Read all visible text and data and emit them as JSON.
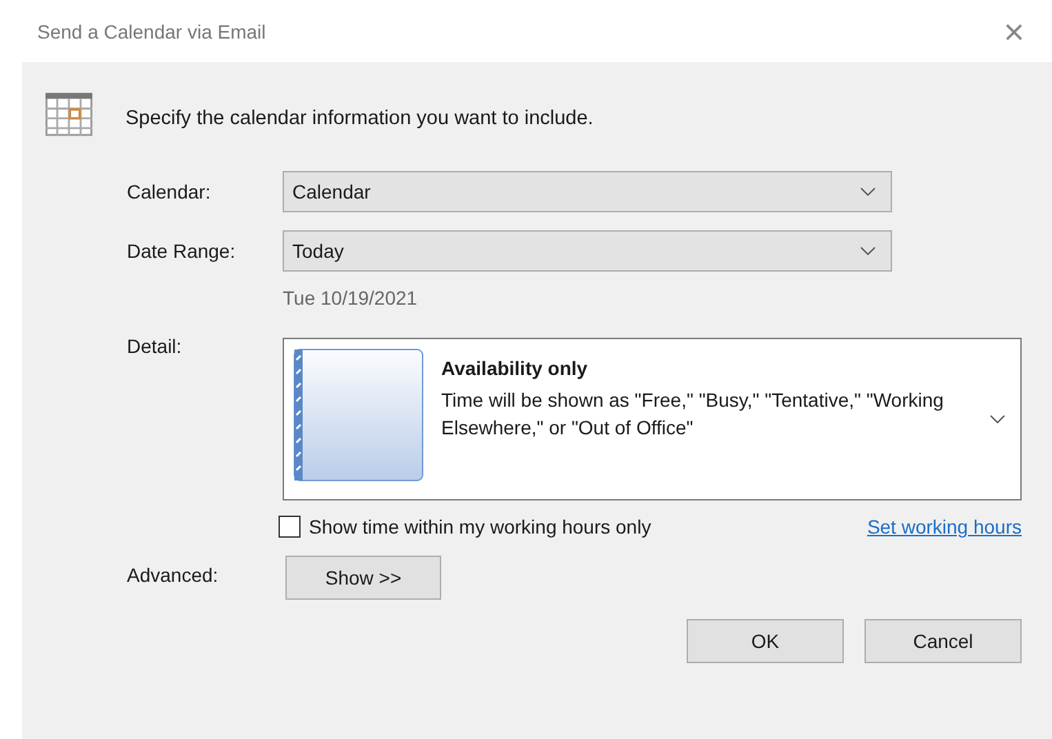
{
  "window": {
    "title": "Send a Calendar via Email",
    "close": "×"
  },
  "heading": "Specify the calendar information you want to include.",
  "fields": [
    {
      "label": "Calendar:",
      "value": "Calendar"
    },
    {
      "label": "Date Range:",
      "value": "Today"
    }
  ],
  "date_note": "Tue 10/19/2021",
  "detail": {
    "label": "Detail:",
    "title": "Availability only",
    "description": "Time will be shown as \"Free,\" \"Busy,\" \"Tentative,\" \"Working Elsewhere,\" or \"Out of Office\""
  },
  "working_hours": {
    "label": "Show time within my working hours only",
    "checked": false,
    "link": "Set working hours"
  },
  "advanced": {
    "label": "Advanced:",
    "button": "Show >>"
  },
  "buttons": [
    "OK",
    "Cancel"
  ]
}
